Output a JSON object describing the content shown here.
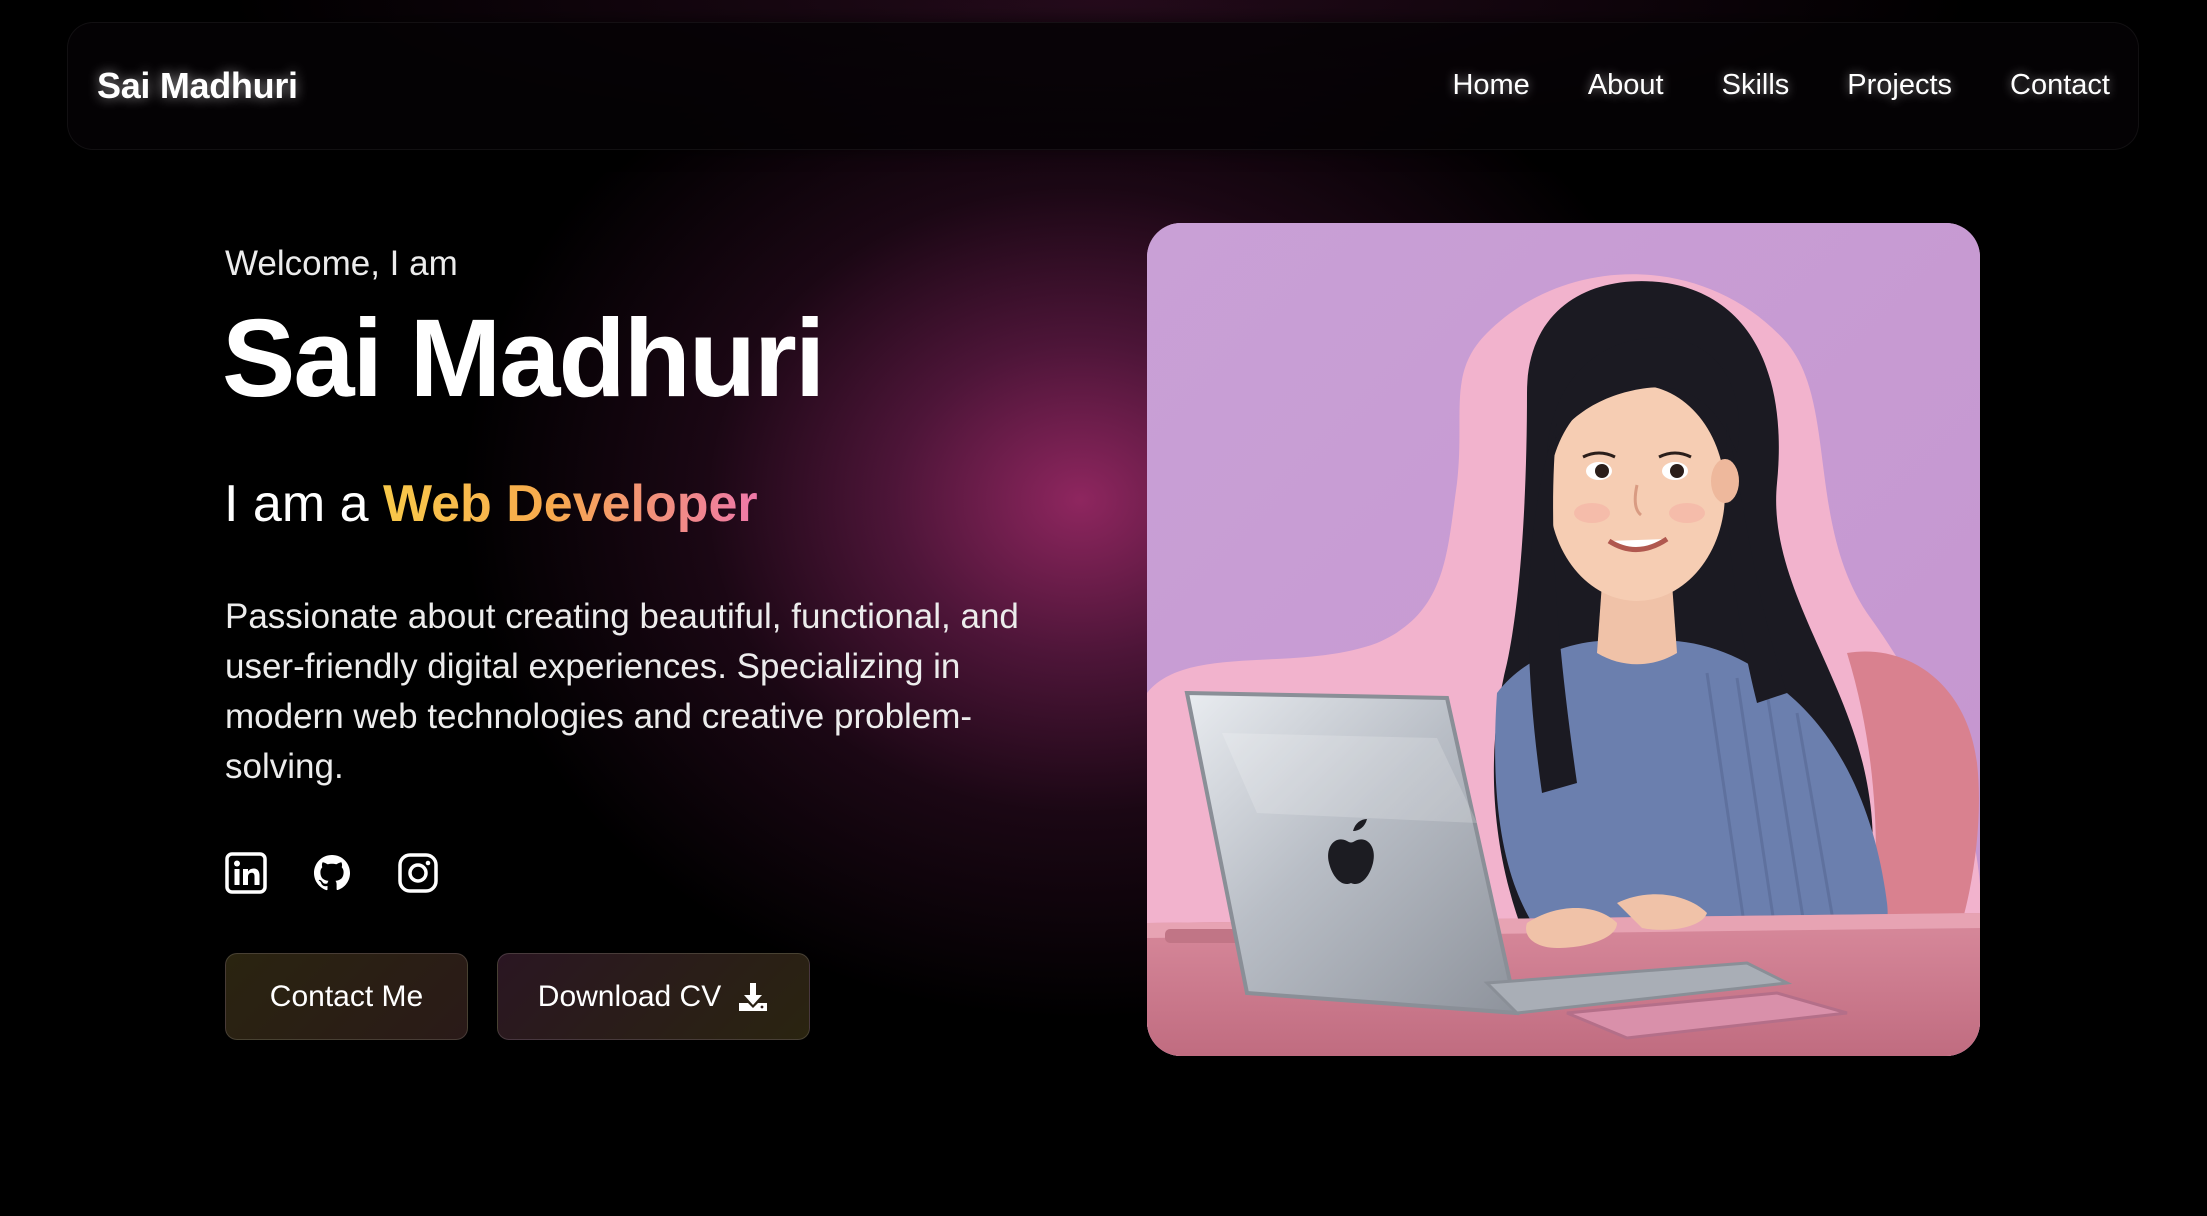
{
  "navbar": {
    "brand": "Sai Madhuri",
    "links": [
      "Home",
      "About",
      "Skills",
      "Projects",
      "Contact"
    ]
  },
  "hero": {
    "greeting": "Welcome, I am",
    "name": "Sai Madhuri",
    "role_prefix": "I am a",
    "role": "Web Developer",
    "description": "Passionate about creating beautiful, functional, and user-friendly digital experiences. Specializing in modern web technologies and creative problem-solving.",
    "socials": [
      "linkedin-icon",
      "github-icon",
      "instagram-icon"
    ],
    "buttons": {
      "contact": "Contact Me",
      "download": "Download CV",
      "download_icon": "download-icon"
    },
    "illustration": "girl-with-laptop-illustration"
  },
  "colors": {
    "background": "#000000",
    "glow": "#8a2a62",
    "role_gradient_start": "#f8c94a",
    "role_gradient_end": "#ee78a9",
    "illustration_bg": "#c99ad2"
  }
}
